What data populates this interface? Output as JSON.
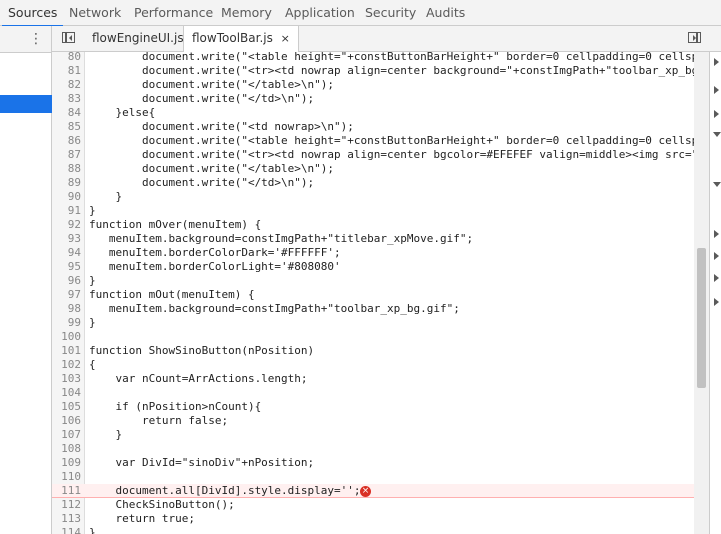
{
  "top_tabs": [
    "Sources",
    "Network",
    "Performance",
    "Memory",
    "Application",
    "Security",
    "Audits"
  ],
  "editor_tabs": [
    {
      "label": "flowEngineUI.js"
    },
    {
      "label": "flowToolBar.js",
      "close": "×"
    }
  ],
  "kebab": "⋮",
  "error_icon": "×",
  "code_lines": [
    {
      "n": "80",
      "t": "        document.write(\"<table height=\"+constButtonBarHeight+\" border=0 cellpadding=0 cellsp"
    },
    {
      "n": "81",
      "t": "        document.write(\"<tr><td nowrap align=center background=\"+constImgPath+\"toolbar_xp_bg"
    },
    {
      "n": "82",
      "t": "        document.write(\"</table>\\n\");"
    },
    {
      "n": "83",
      "t": "        document.write(\"</td>\\n\");"
    },
    {
      "n": "84",
      "t": "    }else{"
    },
    {
      "n": "85",
      "t": "        document.write(\"<td nowrap>\\n\");"
    },
    {
      "n": "86",
      "t": "        document.write(\"<table height=\"+constButtonBarHeight+\" border=0 cellpadding=0 cellsp"
    },
    {
      "n": "87",
      "t": "        document.write(\"<tr><td nowrap align=center bgcolor=#EFEFEF valign=middle><img src=\""
    },
    {
      "n": "88",
      "t": "        document.write(\"</table>\\n\");"
    },
    {
      "n": "89",
      "t": "        document.write(\"</td>\\n\");"
    },
    {
      "n": "90",
      "t": "    }"
    },
    {
      "n": "91",
      "t": "}"
    },
    {
      "n": "92",
      "t": "function mOver(menuItem) {"
    },
    {
      "n": "93",
      "t": "   menuItem.background=constImgPath+\"titlebar_xpMove.gif\";"
    },
    {
      "n": "94",
      "t": "   menuItem.borderColorDark='#FFFFFF';"
    },
    {
      "n": "95",
      "t": "   menuItem.borderColorLight='#808080'"
    },
    {
      "n": "96",
      "t": "}"
    },
    {
      "n": "97",
      "t": "function mOut(menuItem) {"
    },
    {
      "n": "98",
      "t": "   menuItem.background=constImgPath+\"toolbar_xp_bg.gif\";"
    },
    {
      "n": "99",
      "t": "}"
    },
    {
      "n": "100",
      "t": ""
    },
    {
      "n": "101",
      "t": "function ShowSinoButton(nPosition)"
    },
    {
      "n": "102",
      "t": "{"
    },
    {
      "n": "103",
      "t": "    var nCount=ArrActions.length;"
    },
    {
      "n": "104",
      "t": ""
    },
    {
      "n": "105",
      "t": "    if (nPosition>nCount){"
    },
    {
      "n": "106",
      "t": "        return false;"
    },
    {
      "n": "107",
      "t": "    }"
    },
    {
      "n": "108",
      "t": ""
    },
    {
      "n": "109",
      "t": "    var DivId=\"sinoDiv\"+nPosition;"
    },
    {
      "n": "110",
      "t": ""
    },
    {
      "n": "111",
      "t": "    document.all[DivId].style.display='';"
    },
    {
      "n": "112",
      "t": "    CheckSinoButton();"
    },
    {
      "n": "113",
      "t": "    return true;"
    },
    {
      "n": "114",
      "t": "}"
    }
  ],
  "error_line": "111",
  "colors": {
    "accent": "#1a73e8",
    "error": "#d93025"
  }
}
